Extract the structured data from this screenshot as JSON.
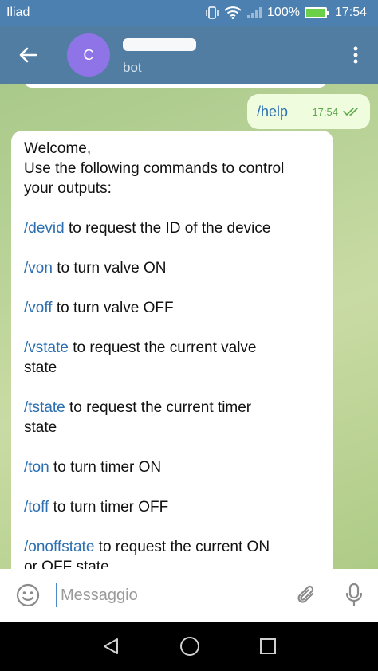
{
  "status_bar": {
    "carrier": "Iliad",
    "battery": "100%",
    "time": "17:54"
  },
  "header": {
    "avatar_letter": "C",
    "subtitle": "bot"
  },
  "messages": {
    "outgoing": {
      "text": "/help",
      "time": "17:54"
    },
    "incoming": {
      "welcome": "Welcome,",
      "intro_1": "Use the following commands to control",
      "intro_2": "your outputs:",
      "commands": [
        {
          "cmd": "/devid",
          "desc": " to request the ID of the device"
        },
        {
          "cmd": "/von",
          "desc": " to turn valve ON"
        },
        {
          "cmd": "/voff",
          "desc": " to turn valve OFF"
        },
        {
          "cmd": "/vstate",
          "desc": " to request the current valve",
          "desc2": "state"
        },
        {
          "cmd": "/tstate",
          "desc": " to request the current timer",
          "desc2": "state"
        },
        {
          "cmd": "/ton",
          "desc": " to turn timer ON"
        },
        {
          "cmd": "/toff",
          "desc": " to turn timer OFF"
        },
        {
          "cmd": "/onoffstate",
          "desc": " to request the current ON",
          "desc2": "or OFF state"
        }
      ]
    }
  },
  "input": {
    "placeholder": "Messaggio"
  },
  "colors": {
    "header": "#517da2",
    "status_bar": "#4b80b0",
    "link": "#2b6fb1",
    "outgoing_bubble": "#effdde",
    "avatar": "#8e74e6"
  },
  "icons": [
    "back-arrow-icon",
    "more-vert-icon",
    "emoji-icon",
    "attach-icon",
    "mic-icon",
    "nav-back-icon",
    "nav-home-icon",
    "nav-recents-icon"
  ]
}
